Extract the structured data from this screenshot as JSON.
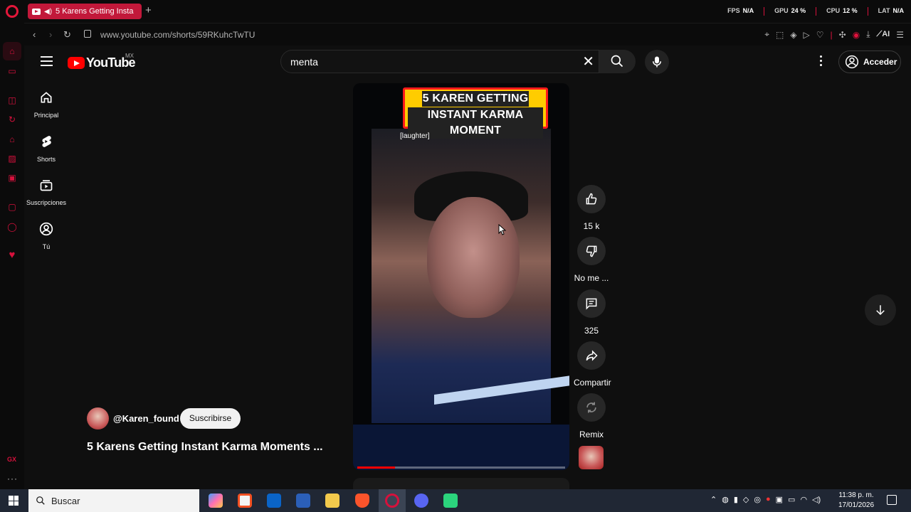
{
  "browser": {
    "tab_title": "5 Karens Getting Instan",
    "url": "www.youtube.com/shorts/59RKuhcTwTU",
    "ai_label": "AI",
    "gx_label": "GX",
    "stats": [
      {
        "label": "FPS",
        "value": "N/A"
      },
      {
        "label": "GPU",
        "value": "24 %"
      },
      {
        "label": "CPU",
        "value": "12 %"
      },
      {
        "label": "LAT",
        "value": "N/A"
      }
    ]
  },
  "header": {
    "logo_text": "YouTube",
    "region": "MX",
    "search_query": "menta",
    "signin_label": "Acceder"
  },
  "guide": {
    "items": [
      {
        "label": "Principal",
        "icon": "home-icon"
      },
      {
        "label": "Shorts",
        "icon": "shorts-icon"
      },
      {
        "label": "Suscripciones",
        "icon": "subscriptions-icon"
      },
      {
        "label": "Tú",
        "icon": "user-icon"
      }
    ]
  },
  "video": {
    "overlay_line1": "5 KAREN GETTING",
    "overlay_line2": "INSTANT KARMA MOMENT",
    "caption": "[laughter]",
    "progress": 0.18
  },
  "actions": {
    "like_count": "15 k",
    "dislike_label": "No me ...",
    "comments_count": "325",
    "share_label": "Compartir",
    "remix_label": "Remix"
  },
  "channel": {
    "handle": "@Karen_found",
    "subscribe_label": "Suscribirse",
    "short_title": "5 Karens Getting Instant Karma Moments ..."
  },
  "taskbar": {
    "search_label": "Buscar",
    "time": "11:38 p. m.",
    "date": "17/01/2026"
  },
  "colors": {
    "opera_accent": "#e3173a",
    "yt_red": "#ff0000",
    "taskbar": "#202734"
  }
}
